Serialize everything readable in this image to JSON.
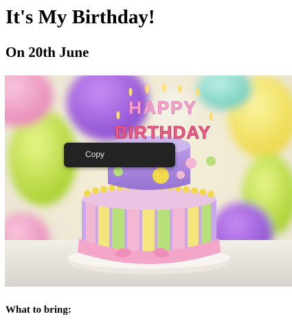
{
  "page": {
    "title": "It's My Birthday!",
    "subtitle": "On 20th June",
    "section_heading": "What to bring:"
  },
  "image": {
    "alt": "Birthday cake",
    "banner_top": "HAPPY",
    "banner_bottom": "BIRTHDAY"
  },
  "context_menu": {
    "items": [
      {
        "label": "Copy"
      }
    ]
  }
}
